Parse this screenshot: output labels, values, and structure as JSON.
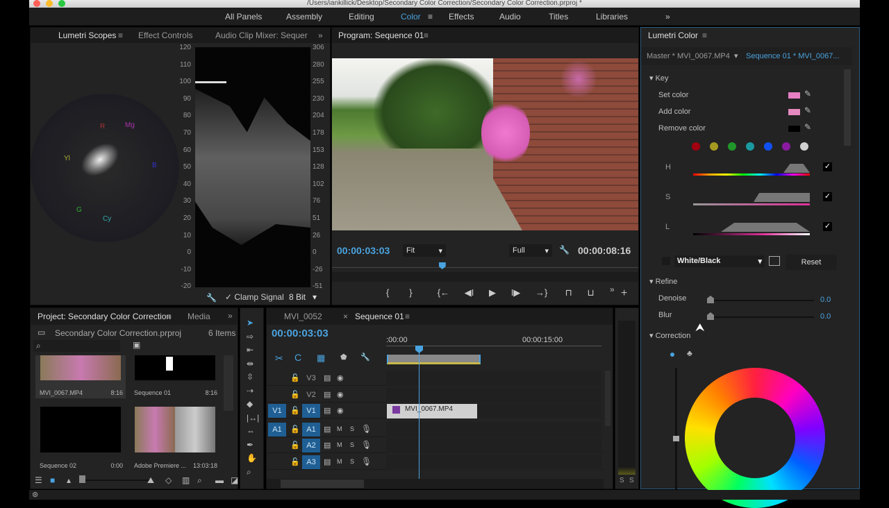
{
  "window": {
    "title": "/Users/iankillick/Desktop/Secondary Color Correction/Secondary Color Correction.prproj *"
  },
  "workspaces": {
    "items": [
      "All Panels",
      "Assembly",
      "Editing",
      "Color",
      "Effects",
      "Audio",
      "Titles",
      "Libraries"
    ],
    "active": "Color",
    "more": "»"
  },
  "scopes": {
    "tabs": [
      "Lumetri Scopes",
      "Effect Controls",
      "Audio Clip Mixer: Sequer"
    ],
    "more": "»",
    "left_axis": [
      "120",
      "110",
      "100",
      "90",
      "80",
      "70",
      "60",
      "50",
      "40",
      "30",
      "20",
      "10",
      "0",
      "-10",
      "-20"
    ],
    "right_axis": [
      "306",
      "280",
      "255",
      "230",
      "204",
      "178",
      "153",
      "128",
      "102",
      "76",
      "51",
      "26",
      "0",
      "-26",
      "-51"
    ],
    "clamp_label": "Clamp Signal",
    "clamp_checked": true,
    "bit_depth": "8 Bit",
    "vector_labels": [
      "R",
      "Mg",
      "B",
      "Cy",
      "G",
      "Yl"
    ]
  },
  "program": {
    "tab": "Program: Sequence 01",
    "timecode": "00:00:03:03",
    "fit": "Fit",
    "quality": "Full",
    "duration": "00:00:08:16",
    "playhead_fraction": 0.36
  },
  "lumetri": {
    "title": "Lumetri Color",
    "master": "Master * MVI_0067.MP4",
    "sequence": "Sequence 01 * MVI_0067...",
    "key": {
      "title": "Key",
      "set_color": "Set color",
      "add_color": "Add color",
      "remove_color": "Remove color",
      "set_swatch": "#e77fc4",
      "add_swatch": "#e58ac0",
      "remove_swatch": "#000000",
      "presets": [
        "#a00010",
        "#a59a20",
        "#20962a",
        "#1a9aa0",
        "#1050f0",
        "#8a1aa0",
        "#d0d0d0"
      ],
      "h_label": "H",
      "s_label": "S",
      "l_label": "L",
      "h_checked": true,
      "s_checked": true,
      "l_checked": true,
      "display": "White/Black",
      "reset": "Reset"
    },
    "refine": {
      "title": "Refine",
      "denoise_label": "Denoise",
      "denoise": "0.0",
      "blur_label": "Blur",
      "blur": "0.0"
    },
    "correction": {
      "title": "Correction"
    }
  },
  "project": {
    "tab": "Project: Secondary Color Correction",
    "media_tab": "Media",
    "more": "»",
    "file": "Secondary Color Correction.prproj",
    "count": "6 Items",
    "items": [
      {
        "name": "MVI_0067.MP4",
        "duration": "8:16"
      },
      {
        "name": "Sequence 01",
        "duration": "8:16"
      },
      {
        "name": "Sequence 02",
        "duration": "0:00"
      },
      {
        "name": "Adobe Premiere ...",
        "duration": "13:03:18"
      }
    ]
  },
  "timeline": {
    "tabs": [
      "MVI_0052",
      "Sequence 01"
    ],
    "timecode": "00:00:03:03",
    "ruler": [
      ":00:00",
      "00:00:15:00"
    ],
    "clip": "MVI_0067.MP4",
    "tracks": [
      {
        "src": "",
        "name": "V3"
      },
      {
        "src": "",
        "name": "V2"
      },
      {
        "src": "V1",
        "name": "V1"
      },
      {
        "src": "A1",
        "name": "A1"
      },
      {
        "src": "",
        "name": "A2"
      },
      {
        "src": "",
        "name": "A3"
      }
    ],
    "m": "M",
    "s": "S"
  },
  "meter": {
    "labels": [
      "S",
      "S"
    ]
  }
}
